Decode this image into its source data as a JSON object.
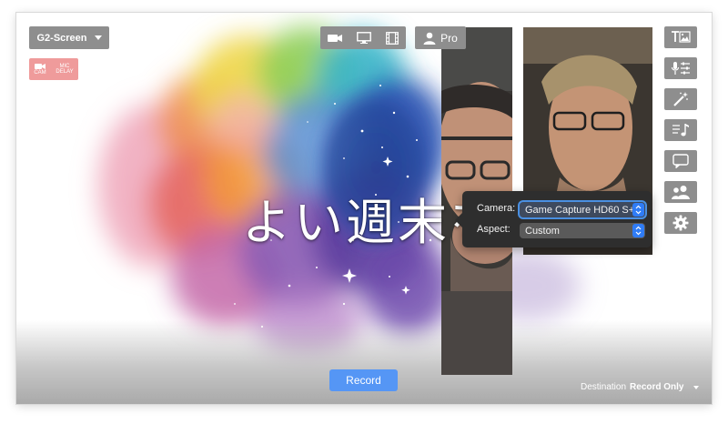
{
  "scene": {
    "name": "G2-Screen",
    "icon": "caret-down-icon"
  },
  "badges": {
    "cam": "CAM",
    "mic_line1": "MIC",
    "mic_line2": "DELAY",
    "color": "#ef9b9b"
  },
  "modes": [
    {
      "icon": "camera-icon"
    },
    {
      "icon": "monitor-icon"
    },
    {
      "icon": "film-icon"
    }
  ],
  "account": {
    "label": "Pro",
    "icon": "person-icon"
  },
  "overlay_text": "よい週末を",
  "tools": [
    {
      "icon": "text-image-icon"
    },
    {
      "icon": "mic-mixer-icon"
    },
    {
      "icon": "magic-wand-icon"
    },
    {
      "icon": "music-icon"
    },
    {
      "icon": "speech-bubble-icon"
    },
    {
      "icon": "people-icon"
    },
    {
      "icon": "gear-icon"
    }
  ],
  "popover": {
    "camera_label": "Camera:",
    "camera_value": "Game Capture HD60 S+",
    "aspect_label": "Aspect:",
    "aspect_value": "Custom"
  },
  "record_button": "Record",
  "destination": {
    "label": "Destination",
    "value": "Record Only"
  },
  "colors": {
    "accent": "#5596f5",
    "toolbar": "#8e8e8e",
    "popover": "#2e2e2e"
  }
}
